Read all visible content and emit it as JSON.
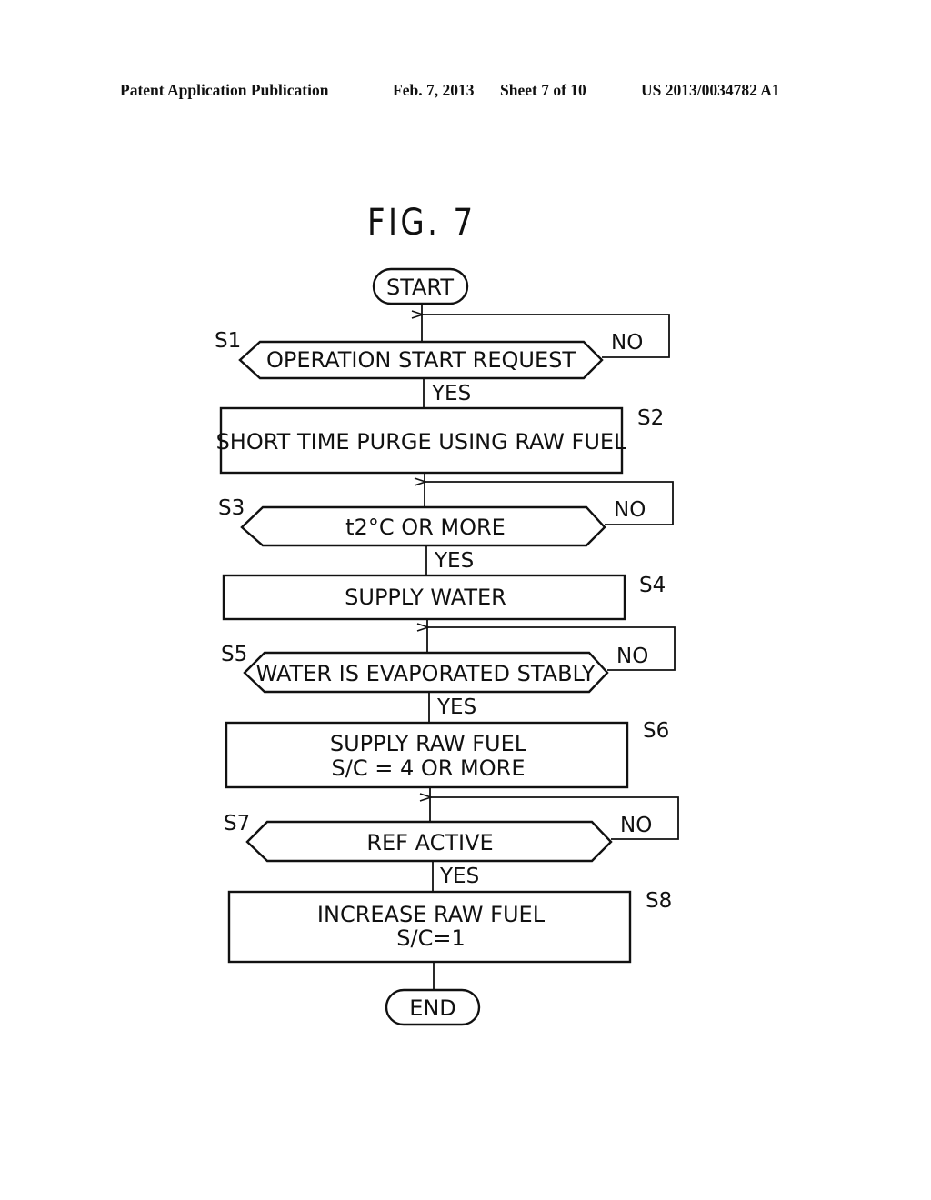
{
  "header": {
    "publication": "Patent Application Publication",
    "date": "Feb. 7, 2013",
    "sheet": "Sheet 7 of 10",
    "number": "US 2013/0034782 A1"
  },
  "figure": {
    "title": "FIG. 7"
  },
  "flowchart": {
    "start": "START",
    "end": "END",
    "yes_label": "YES",
    "no_label": "NO",
    "steps": [
      {
        "id": "S1",
        "type": "decision",
        "lines": [
          "OPERATION START REQUEST"
        ]
      },
      {
        "id": "S2",
        "type": "process",
        "lines": [
          "SHORT TIME PURGE USING RAW FUEL"
        ]
      },
      {
        "id": "S3",
        "type": "decision",
        "lines": [
          "t2°C OR MORE"
        ]
      },
      {
        "id": "S4",
        "type": "process",
        "lines": [
          "SUPPLY WATER"
        ]
      },
      {
        "id": "S5",
        "type": "decision",
        "lines": [
          "WATER IS EVAPORATED STABLY"
        ]
      },
      {
        "id": "S6",
        "type": "process",
        "lines": [
          "SUPPLY RAW FUEL",
          "S/C = 4 OR MORE"
        ]
      },
      {
        "id": "S7",
        "type": "decision",
        "lines": [
          "REF ACTIVE"
        ]
      },
      {
        "id": "S8",
        "type": "process",
        "lines": [
          "INCREASE RAW FUEL",
          "S/C=1"
        ]
      }
    ]
  }
}
